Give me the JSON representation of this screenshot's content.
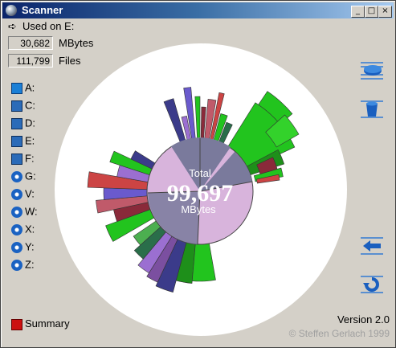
{
  "window": {
    "title": "Scanner",
    "controls": {
      "minimize": "_",
      "maximize": "□",
      "close": "×"
    }
  },
  "used_on": {
    "arrow": "➪",
    "label": "Used on E:"
  },
  "stats": {
    "mbytes_value": "30,682",
    "mbytes_label": "MBytes",
    "files_value": "111,799",
    "files_label": "Files"
  },
  "drives": [
    {
      "label": "A:",
      "icon": "floppy-icon"
    },
    {
      "label": "C:",
      "icon": "hard-disk-icon"
    },
    {
      "label": "D:",
      "icon": "hard-disk-icon"
    },
    {
      "label": "E:",
      "icon": "hard-disk-icon"
    },
    {
      "label": "F:",
      "icon": "hard-disk-icon"
    },
    {
      "label": "G:",
      "icon": "cd-drive-icon"
    },
    {
      "label": "V:",
      "icon": "cd-drive-icon"
    },
    {
      "label": "W:",
      "icon": "cd-drive-icon"
    },
    {
      "label": "X:",
      "icon": "cd-drive-icon"
    },
    {
      "label": "Y:",
      "icon": "cd-drive-icon"
    },
    {
      "label": "Z:",
      "icon": "cd-drive-icon"
    }
  ],
  "right_buttons": [
    {
      "name": "disk-button",
      "icon": "disk-icon"
    },
    {
      "name": "trash-button",
      "icon": "trash-icon"
    },
    {
      "name": "back-button",
      "icon": "back-arrow-icon"
    },
    {
      "name": "refresh-button",
      "icon": "refresh-icon"
    }
  ],
  "summary": {
    "label": "Summary",
    "icon": "summary-icon"
  },
  "center": {
    "top_label": "Total",
    "value": "99,697",
    "unit_label": "MBytes"
  },
  "version": "Version 2.0",
  "copyright": "© Steffen Gerlach 1999",
  "colors": {
    "titlebar": "#0a246a",
    "window_bg": "#d4d0c8",
    "sunburst_lilac": "#d8b4dc",
    "sunburst_slate": "#7a7a9c"
  }
}
